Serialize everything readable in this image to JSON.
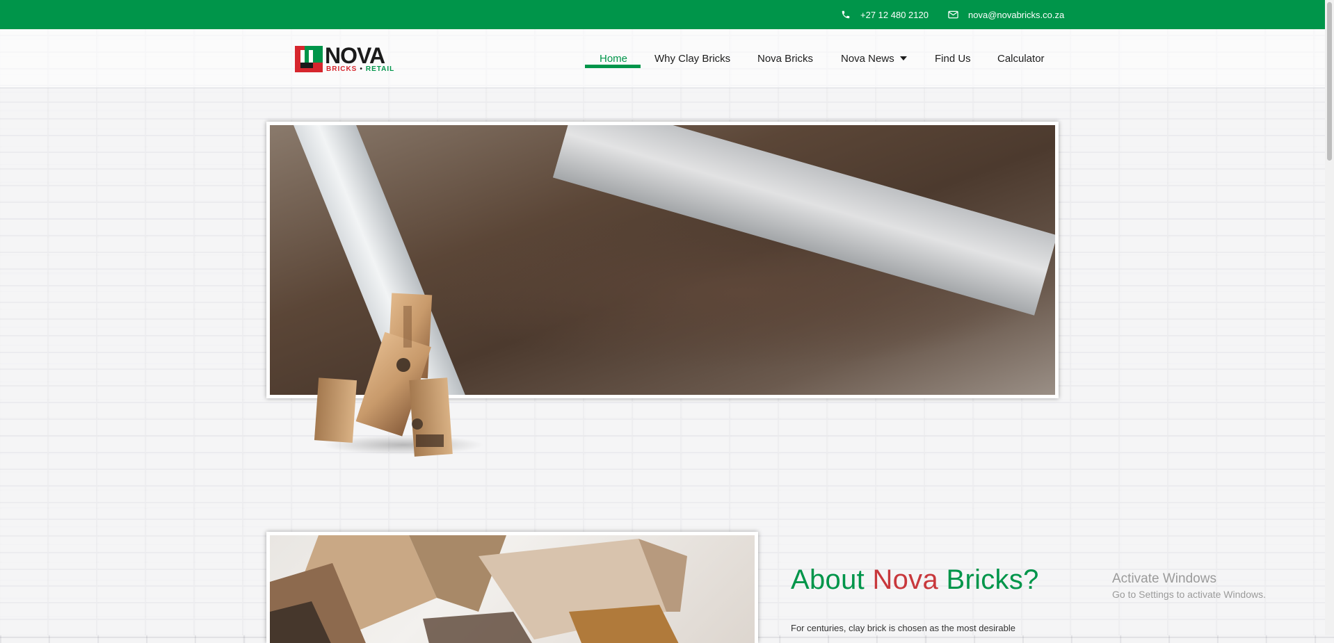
{
  "topbar": {
    "phone": "+27 12 480 2120",
    "email": "nova@novabricks.co.za",
    "phone_icon": "phone-icon",
    "email_icon": "envelope-icon",
    "color": "#00954a"
  },
  "logo": {
    "word": "NOVA",
    "sub_bricks": "BRICKS",
    "sub_dot": "•",
    "sub_retail": "RETAIL"
  },
  "nav": {
    "items": [
      {
        "label": "Home",
        "active": true
      },
      {
        "label": "Why Clay Bricks"
      },
      {
        "label": "Nova Bricks"
      },
      {
        "label": "Nova News",
        "has_dropdown": true
      },
      {
        "label": "Find Us"
      },
      {
        "label": "Calculator"
      }
    ]
  },
  "about": {
    "title_part1": "About",
    "title_part2": "Nova",
    "title_part3": "Bricks?",
    "body": "For centuries, clay brick is chosen as the most desirable"
  },
  "watermark": {
    "title": "Activate Windows",
    "subtitle": "Go to Settings to activate Windows."
  },
  "colors": {
    "brand_green": "#00954a",
    "brand_red": "#c8383c"
  }
}
